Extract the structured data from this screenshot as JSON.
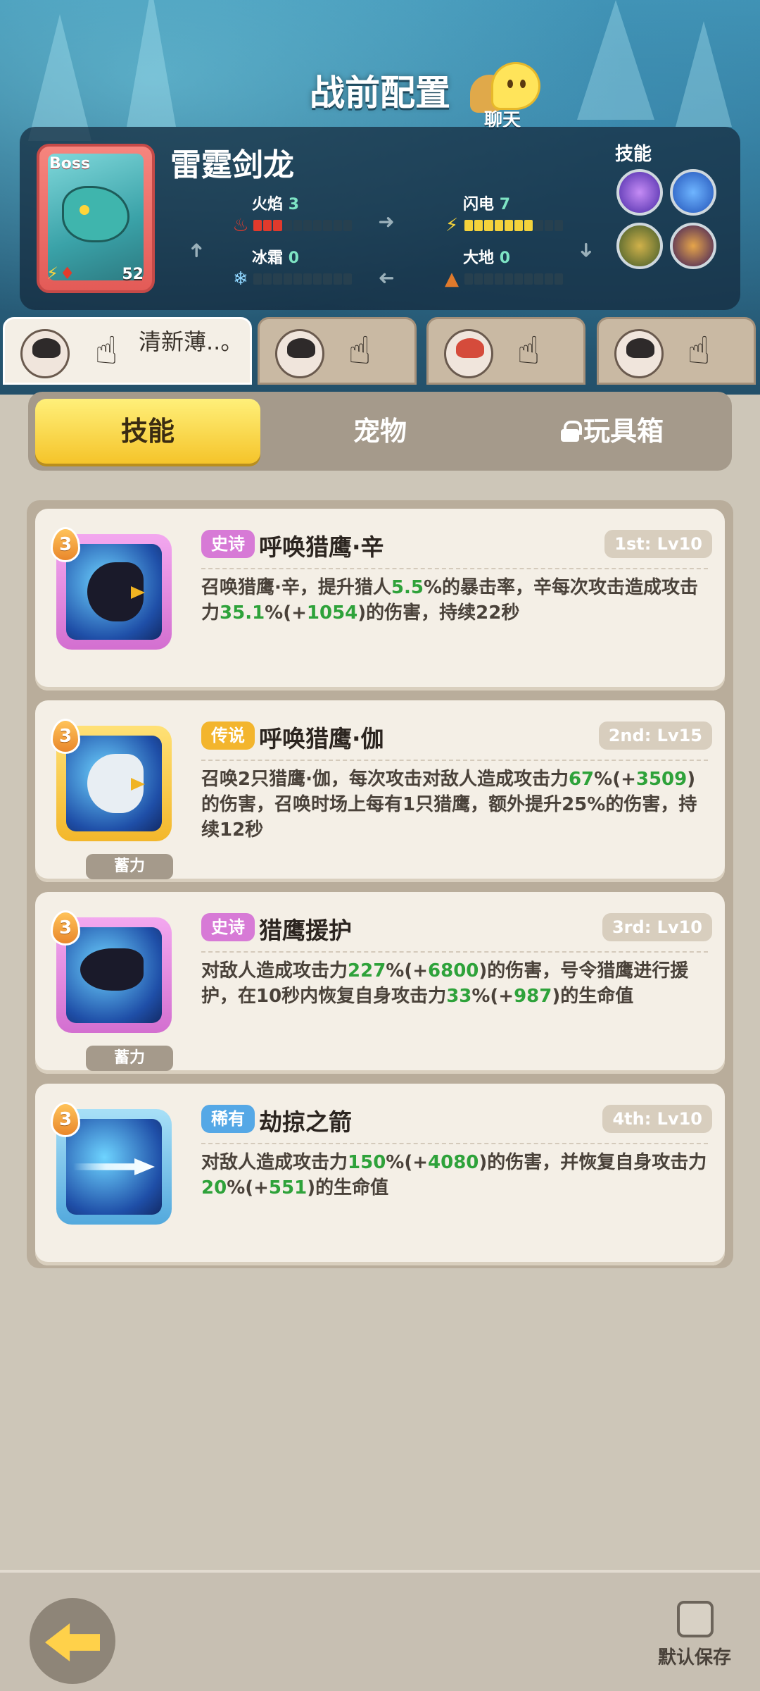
{
  "header": {
    "title": "战前配置",
    "chat_label": "聊天"
  },
  "boss": {
    "tag": "Boss",
    "name": "雷霆剑龙",
    "level": "52",
    "skills_label": "技能",
    "elements": [
      {
        "label": "火焰",
        "value": "3",
        "filled": 3,
        "color": "#e13a2c",
        "icon": "fire-icon"
      },
      {
        "label": "闪电",
        "value": "7",
        "filled": 7,
        "color": "#f4d23b",
        "icon": "lightning-icon"
      },
      {
        "label": "冰霜",
        "value": "0",
        "filled": 0,
        "color": "#7ec7f0",
        "icon": "snowflake-icon"
      },
      {
        "label": "大地",
        "value": "0",
        "filled": 0,
        "color": "#e07a2c",
        "icon": "earth-icon"
      }
    ]
  },
  "players": [
    {
      "name": "清新薄..。",
      "active": true
    },
    {
      "name": "",
      "active": false
    },
    {
      "name": "",
      "active": false
    },
    {
      "name": "",
      "active": false
    }
  ],
  "mode_tabs": [
    {
      "label": "技能",
      "active": true,
      "locked": false
    },
    {
      "label": "宠物",
      "active": false,
      "locked": false
    },
    {
      "label": "玩具箱",
      "active": false,
      "locked": true
    }
  ],
  "skills": [
    {
      "rarity": "史诗",
      "rarity_class": "epic",
      "name": "呼唤猎鹰·辛",
      "slot": "1st: Lv10",
      "count": "3",
      "charge": "",
      "desc": [
        {
          "t": "召唤猎鹰·辛，提升猎人"
        },
        {
          "t": "5.5",
          "g": true
        },
        {
          "t": "%的暴击率，辛每次攻击造成攻击力"
        },
        {
          "t": "35.1",
          "g": true
        },
        {
          "t": "%(+"
        },
        {
          "t": "1054",
          "g": true
        },
        {
          "t": ")的伤害，持续22秒"
        }
      ]
    },
    {
      "rarity": "传说",
      "rarity_class": "leg",
      "name": "呼唤猎鹰·伽",
      "slot": "2nd: Lv15",
      "count": "3",
      "charge": "蓄力",
      "desc": [
        {
          "t": "召唤2只猎鹰·伽，每次攻击对敌人造成攻击力"
        },
        {
          "t": "67",
          "g": true
        },
        {
          "t": "%(+"
        },
        {
          "t": "3509",
          "g": true
        },
        {
          "t": ")的伤害，召唤时场上每有1只猎鹰，额外提升25%的伤害，持续12秒"
        }
      ]
    },
    {
      "rarity": "史诗",
      "rarity_class": "epic",
      "name": "猎鹰援护",
      "slot": "3rd: Lv10",
      "count": "3",
      "charge": "蓄力",
      "desc": [
        {
          "t": "对敌人造成攻击力"
        },
        {
          "t": "227",
          "g": true
        },
        {
          "t": "%(+"
        },
        {
          "t": "6800",
          "g": true
        },
        {
          "t": ")的伤害，号令猎鹰进行援护，在10秒内恢复自身攻击力"
        },
        {
          "t": "33",
          "g": true
        },
        {
          "t": "%(+"
        },
        {
          "t": "987",
          "g": true
        },
        {
          "t": ")的生命值"
        }
      ]
    },
    {
      "rarity": "稀有",
      "rarity_class": "rare",
      "name": "劫掠之箭",
      "slot": "4th: Lv10",
      "count": "3",
      "charge": "",
      "desc": [
        {
          "t": "对敌人造成攻击力"
        },
        {
          "t": "150",
          "g": true
        },
        {
          "t": "%(+"
        },
        {
          "t": "4080",
          "g": true
        },
        {
          "t": ")的伤害，并恢复自身攻击力"
        },
        {
          "t": "20",
          "g": true
        },
        {
          "t": "%(+"
        },
        {
          "t": "551",
          "g": true
        },
        {
          "t": ")的生命值"
        }
      ]
    }
  ],
  "footer": {
    "save_label": "默认保存"
  }
}
